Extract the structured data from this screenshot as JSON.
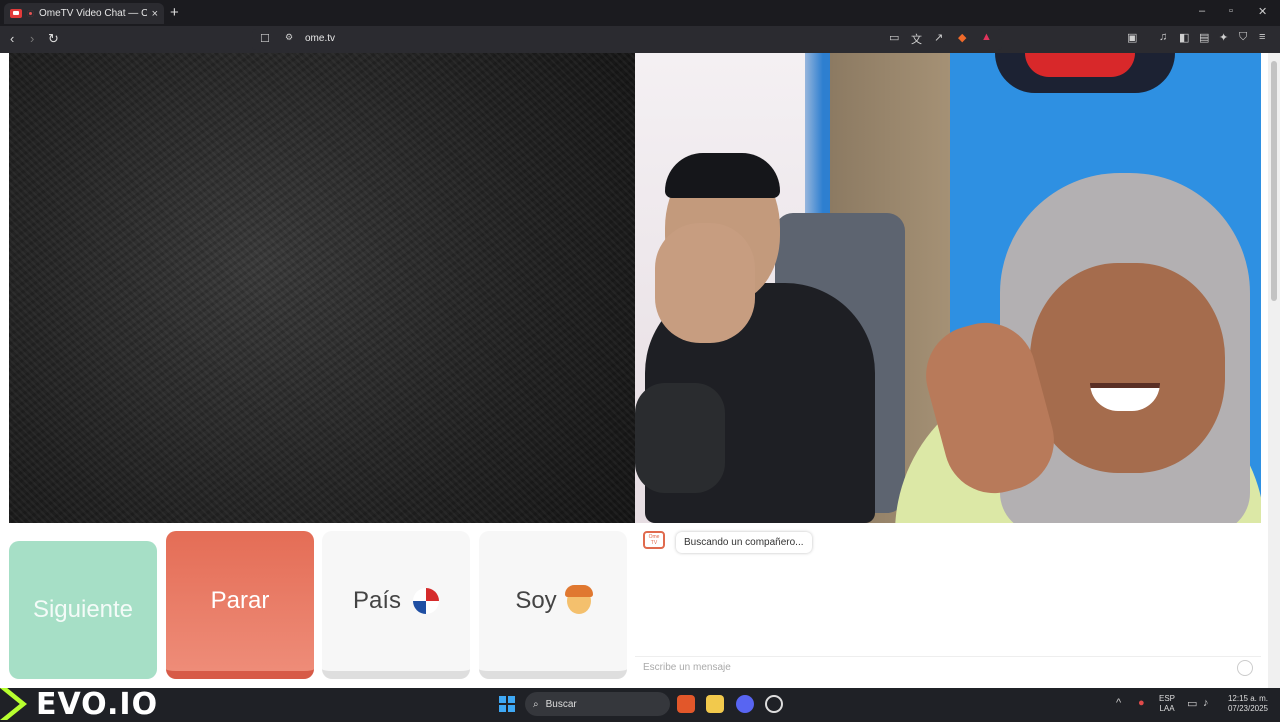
{
  "browser": {
    "tab_title": "OmeTV Video Chat — Omeg",
    "url": "ome.tv",
    "new_tab": "+",
    "close_tab": "×"
  },
  "window_controls": {
    "minimize": "–",
    "restore": "▫",
    "close": "✕"
  },
  "nav_icons": {
    "back": "‹",
    "forward": "›",
    "reload": "↻",
    "bookmark": "☐",
    "site_info": "⚙"
  },
  "controls": {
    "next_label": "Siguiente",
    "stop_label": "Parar",
    "country_label": "País",
    "soy_label": "Soy"
  },
  "chat": {
    "logo_text": "Ome TV",
    "status_message": "Buscando un compañero...",
    "input_placeholder": "Escribe un mensaje"
  },
  "taskbar": {
    "brand": "EVO.IO",
    "search_label": "Buscar",
    "lang_top": "ESP",
    "lang_bottom": "LAA",
    "time": "12:15 a. m.",
    "date": "07/23/2025"
  },
  "colors": {
    "next_bg": "#a6dfc6",
    "stop_bg": "#e46d56",
    "evo_accent": "#b7ff2f"
  }
}
